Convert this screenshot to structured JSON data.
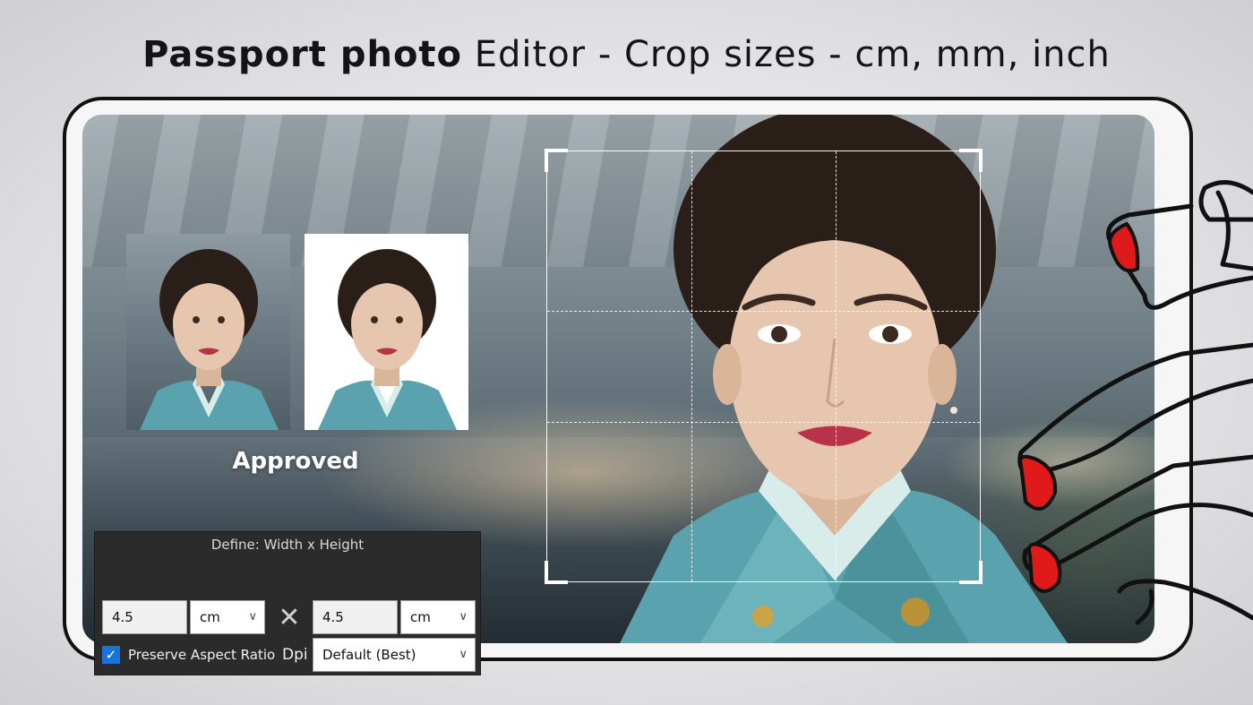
{
  "headline": {
    "bold": "Passport photo",
    "rest": " Editor - Crop sizes - cm, mm, inch"
  },
  "thumbnails": {
    "approved_label": "Approved"
  },
  "panel": {
    "title": "Define: Width x Height",
    "width_value": "4.5",
    "width_unit": "cm",
    "times_symbol": "✕",
    "height_value": "4.5",
    "height_unit": "cm",
    "preserve_aspect_label": "Preserve Aspect Ratio",
    "preserve_aspect_checked": true,
    "dpi_label": "Dpi",
    "dpi_value": "Default (Best)"
  },
  "icons": {
    "chevron": "chevron-down-icon",
    "check": "checkmark-icon",
    "multiply": "multiply-icon"
  },
  "colors": {
    "panel_bg": "#2b2b2b",
    "checkbox_accent": "#1b74d4",
    "nail_red": "#e01a1a",
    "uniform_teal": "#5aa3ae"
  }
}
